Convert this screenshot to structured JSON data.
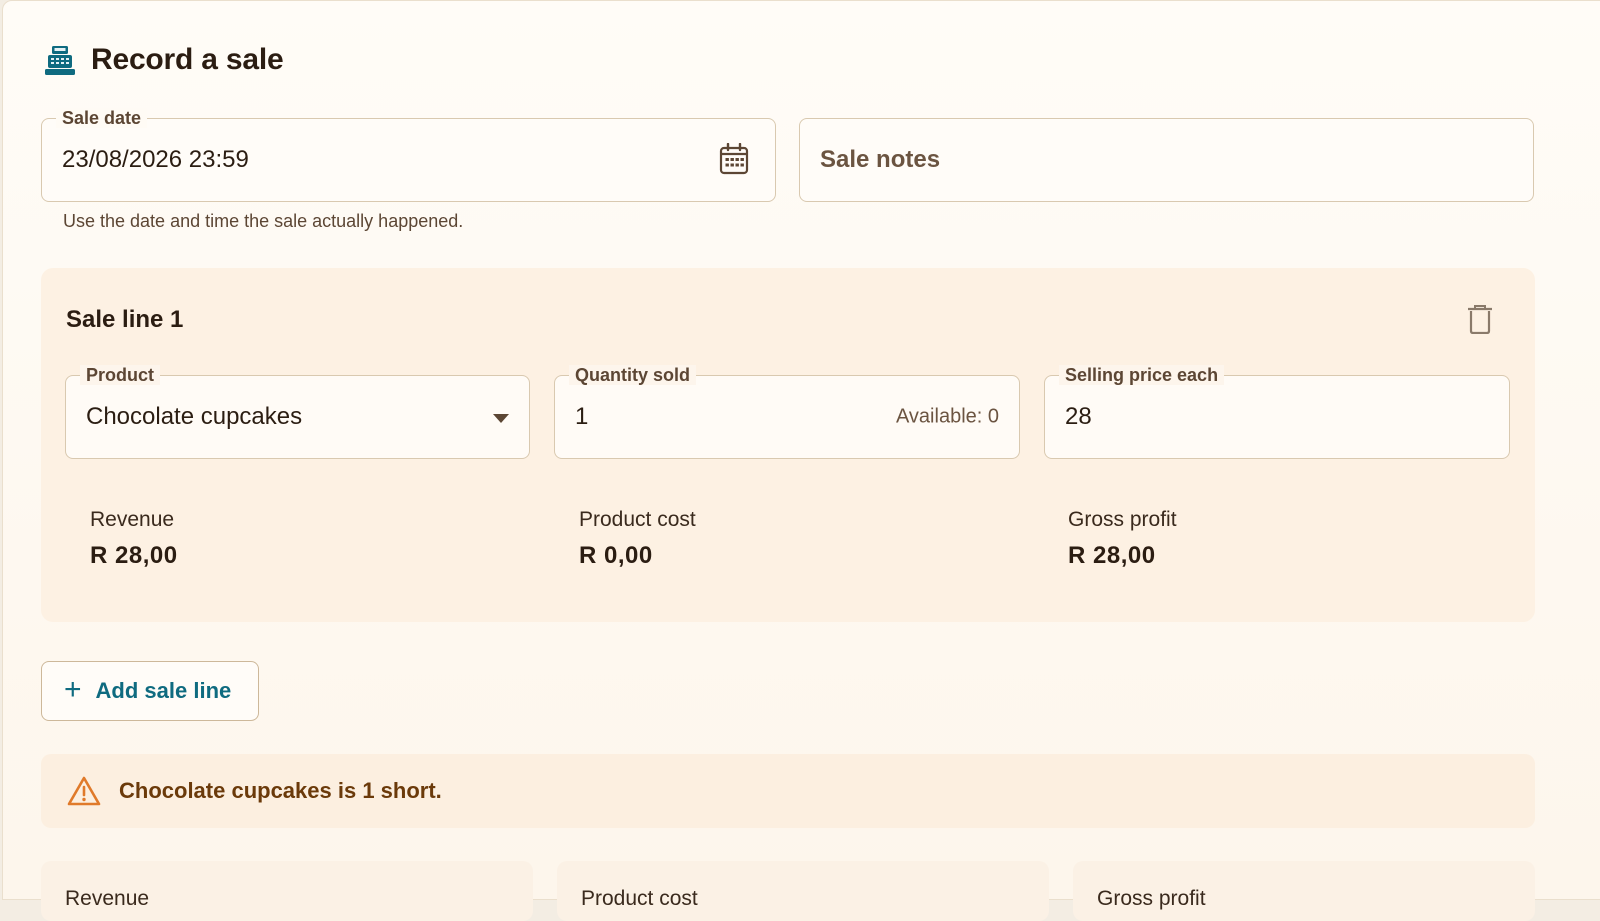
{
  "header": {
    "title": "Record a sale",
    "icon": "cash-register-icon"
  },
  "sale_date": {
    "legend": "Sale date",
    "value": "23/08/2026 23:59",
    "helper": "Use the date and time the sale actually happened."
  },
  "sale_notes": {
    "placeholder": "Sale notes"
  },
  "line": {
    "title": "Sale line 1",
    "product": {
      "legend": "Product",
      "value": "Chocolate cupcakes"
    },
    "quantity": {
      "legend": "Quantity sold",
      "value": "1",
      "available": "Available: 0"
    },
    "price": {
      "legend": "Selling price each",
      "value": "28"
    },
    "revenue": {
      "label": "Revenue",
      "value": "R 28,00"
    },
    "cost": {
      "label": "Product cost",
      "value": "R 0,00"
    },
    "profit": {
      "label": "Gross profit",
      "value": "R 28,00"
    }
  },
  "add_line": {
    "label": "Add sale line"
  },
  "warning": {
    "message": "Chocolate cupcakes is 1 short.",
    "color": "#e07a2a"
  },
  "summary": {
    "revenue_label": "Revenue",
    "cost_label": "Product cost",
    "profit_label": "Gross profit"
  },
  "colors": {
    "accent": "#0f6b80",
    "background": "#fdf6ec",
    "panel": "#fdf1e3"
  }
}
